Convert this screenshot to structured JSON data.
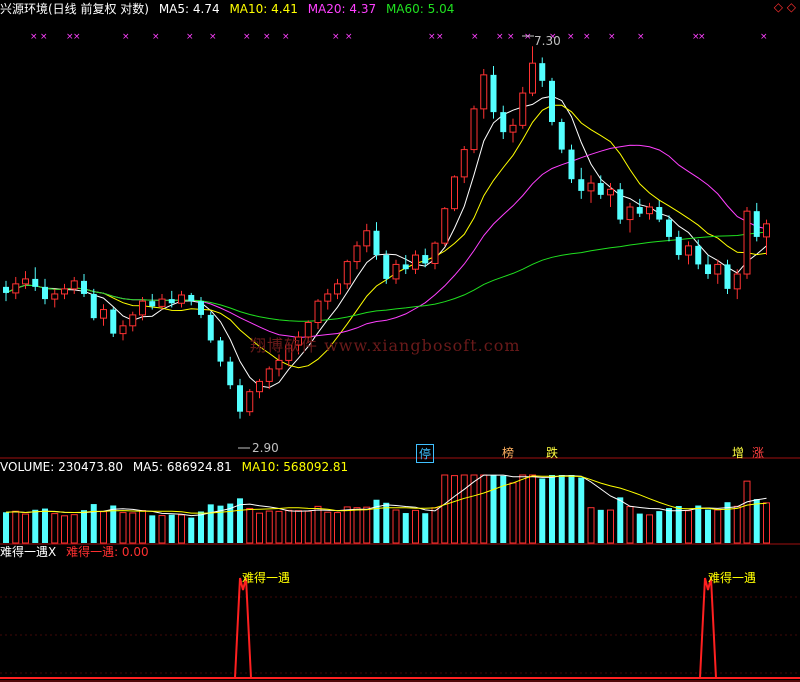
{
  "header": {
    "stock_name": "兴源环境(日线 前复权 对数)",
    "ma5_label": "MA5: 4.74",
    "ma10_label": "MA10: 4.41",
    "ma20_label": "MA20: 4.37",
    "ma60_label": "MA60: 5.04",
    "corner_icons": "◇ ◇",
    "colors": {
      "ma5": "#ffffff",
      "ma10": "#ffff00",
      "ma20": "#ff40ff",
      "ma60": "#20e020"
    }
  },
  "price_panel": {
    "high_marker": "7.30",
    "low_marker": "2.90",
    "watermark": "翔博软件 www.xiangbosoft.com",
    "badges": [
      {
        "text": "停",
        "color": "#40c0ff"
      },
      {
        "text": "榜",
        "color": "#ffb060"
      },
      {
        "text": "跌",
        "color": "#ffff40"
      },
      {
        "text": "增",
        "color": "#ffff40"
      },
      {
        "text": "涨",
        "color": "#ff4040"
      }
    ]
  },
  "volume_panel": {
    "volume_label": "VOLUME: 230473.80",
    "ma5_label": "MA5: 686924.81",
    "ma10_label": "MA10: 568092.81"
  },
  "indicator_panel": {
    "name_label": "难得一遇X",
    "value_label": "难得一遇: 0.00",
    "signal_label_1": "难得一遇",
    "signal_label_2": "难得一遇"
  },
  "chart_data": {
    "type": "candlestick",
    "price_range": [
      2.9,
      7.3
    ],
    "price_scale": "log",
    "candles": [
      [
        4.02,
        4.08,
        3.88,
        3.96
      ],
      [
        3.96,
        4.12,
        3.9,
        4.05
      ],
      [
        4.05,
        4.18,
        4.0,
        4.1
      ],
      [
        4.1,
        4.22,
        3.98,
        4.02
      ],
      [
        4.02,
        4.1,
        3.85,
        3.9
      ],
      [
        3.9,
        4.0,
        3.82,
        3.95
      ],
      [
        3.95,
        4.05,
        3.9,
        4.0
      ],
      [
        4.0,
        4.12,
        3.95,
        4.08
      ],
      [
        4.08,
        4.15,
        3.92,
        3.95
      ],
      [
        3.95,
        4.0,
        3.7,
        3.72
      ],
      [
        3.72,
        3.85,
        3.65,
        3.8
      ],
      [
        3.8,
        3.82,
        3.55,
        3.58
      ],
      [
        3.58,
        3.7,
        3.52,
        3.65
      ],
      [
        3.65,
        3.78,
        3.6,
        3.75
      ],
      [
        3.75,
        3.92,
        3.7,
        3.88
      ],
      [
        3.88,
        3.95,
        3.8,
        3.83
      ],
      [
        3.83,
        3.95,
        3.8,
        3.9
      ],
      [
        3.9,
        3.98,
        3.82,
        3.86
      ],
      [
        3.86,
        3.98,
        3.82,
        3.94
      ],
      [
        3.94,
        3.96,
        3.84,
        3.88
      ],
      [
        3.88,
        3.92,
        3.72,
        3.75
      ],
      [
        3.75,
        3.78,
        3.5,
        3.52
      ],
      [
        3.52,
        3.55,
        3.3,
        3.34
      ],
      [
        3.34,
        3.38,
        3.12,
        3.15
      ],
      [
        3.15,
        3.2,
        2.9,
        2.95
      ],
      [
        2.95,
        3.12,
        2.92,
        3.1
      ],
      [
        3.1,
        3.2,
        3.05,
        3.18
      ],
      [
        3.18,
        3.3,
        3.12,
        3.28
      ],
      [
        3.28,
        3.4,
        3.22,
        3.35
      ],
      [
        3.35,
        3.5,
        3.3,
        3.48
      ],
      [
        3.48,
        3.6,
        3.4,
        3.55
      ],
      [
        3.55,
        3.7,
        3.5,
        3.68
      ],
      [
        3.68,
        3.9,
        3.62,
        3.88
      ],
      [
        3.88,
        4.0,
        3.8,
        3.95
      ],
      [
        3.95,
        4.1,
        3.9,
        4.05
      ],
      [
        4.05,
        4.3,
        4.0,
        4.28
      ],
      [
        4.28,
        4.5,
        4.2,
        4.45
      ],
      [
        4.45,
        4.7,
        4.38,
        4.62
      ],
      [
        4.62,
        4.72,
        4.3,
        4.35
      ],
      [
        4.35,
        4.4,
        4.05,
        4.1
      ],
      [
        4.1,
        4.3,
        4.05,
        4.25
      ],
      [
        4.25,
        4.35,
        4.15,
        4.2
      ],
      [
        4.2,
        4.4,
        4.15,
        4.35
      ],
      [
        4.35,
        4.42,
        4.22,
        4.26
      ],
      [
        4.26,
        4.5,
        4.2,
        4.48
      ],
      [
        4.48,
        4.9,
        4.45,
        4.88
      ],
      [
        4.88,
        5.3,
        4.85,
        5.28
      ],
      [
        5.28,
        5.7,
        5.2,
        5.65
      ],
      [
        5.65,
        6.3,
        5.6,
        6.25
      ],
      [
        6.25,
        6.9,
        6.1,
        6.8
      ],
      [
        6.8,
        6.95,
        6.1,
        6.2
      ],
      [
        6.2,
        6.3,
        5.8,
        5.9
      ],
      [
        5.9,
        6.1,
        5.75,
        6.0
      ],
      [
        6.0,
        6.6,
        5.95,
        6.5
      ],
      [
        6.5,
        7.3,
        6.45,
        7.0
      ],
      [
        7.0,
        7.1,
        6.6,
        6.7
      ],
      [
        6.7,
        6.75,
        6.0,
        6.05
      ],
      [
        6.05,
        6.1,
        5.6,
        5.65
      ],
      [
        5.65,
        5.72,
        5.2,
        5.25
      ],
      [
        5.25,
        5.4,
        5.0,
        5.1
      ],
      [
        5.1,
        5.3,
        4.95,
        5.2
      ],
      [
        5.2,
        5.3,
        5.0,
        5.05
      ],
      [
        5.05,
        5.2,
        4.9,
        5.12
      ],
      [
        5.12,
        5.2,
        4.7,
        4.75
      ],
      [
        4.75,
        4.95,
        4.6,
        4.9
      ],
      [
        4.9,
        5.0,
        4.78,
        4.82
      ],
      [
        4.82,
        4.95,
        4.75,
        4.9
      ],
      [
        4.9,
        4.98,
        4.72,
        4.75
      ],
      [
        4.75,
        4.8,
        4.5,
        4.55
      ],
      [
        4.55,
        4.62,
        4.3,
        4.35
      ],
      [
        4.35,
        4.5,
        4.25,
        4.45
      ],
      [
        4.45,
        4.52,
        4.2,
        4.25
      ],
      [
        4.25,
        4.35,
        4.1,
        4.15
      ],
      [
        4.15,
        4.3,
        4.05,
        4.25
      ],
      [
        4.25,
        4.3,
        3.95,
        4.0
      ],
      [
        4.0,
        4.2,
        3.9,
        4.15
      ],
      [
        4.15,
        4.9,
        4.1,
        4.85
      ],
      [
        4.85,
        4.95,
        4.5,
        4.55
      ],
      [
        4.55,
        4.75,
        4.35,
        4.7
      ]
    ]
  }
}
